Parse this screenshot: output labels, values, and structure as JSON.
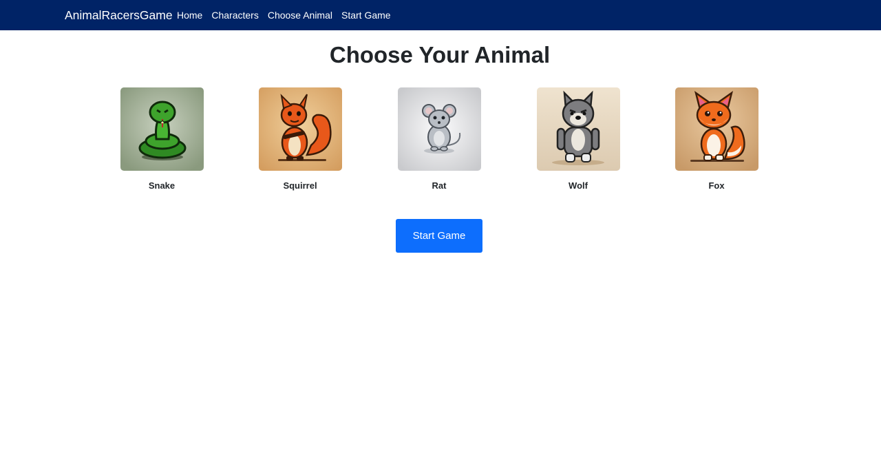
{
  "navbar": {
    "brand": "AnimalRacersGame",
    "links": [
      "Home",
      "Characters",
      "Choose Animal",
      "Start Game"
    ]
  },
  "main": {
    "title": "Choose Your Animal",
    "animals": [
      {
        "name": "Snake",
        "icon": "snake-icon",
        "bg": "#9aa88f"
      },
      {
        "name": "Squirrel",
        "icon": "squirrel-icon",
        "bg": "#d9a66b"
      },
      {
        "name": "Rat",
        "icon": "rat-icon",
        "bg": "#d9dadc"
      },
      {
        "name": "Wolf",
        "icon": "wolf-icon",
        "bg": "#e6d8c2"
      },
      {
        "name": "Fox",
        "icon": "fox-icon",
        "bg": "#d2a678"
      }
    ],
    "start_button": "Start Game"
  },
  "colors": {
    "navbar_bg": "#002366",
    "button_bg": "#0d6efd",
    "text": "#212529"
  }
}
